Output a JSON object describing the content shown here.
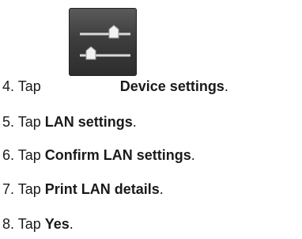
{
  "icon": {
    "name": "settings-sliders-icon",
    "color": "#3d3d3d"
  },
  "steps": [
    {
      "num": "4.",
      "verb": "Tap",
      "target": "Device settings",
      "punct": "."
    },
    {
      "num": "5.",
      "verb": "Tap",
      "target": "LAN settings",
      "punct": "."
    },
    {
      "num": "6.",
      "verb": "Tap",
      "target": "Confirm LAN settings",
      "punct": "."
    },
    {
      "num": "7.",
      "verb": "Tap",
      "target": "Print LAN details",
      "punct": "."
    },
    {
      "num": "8.",
      "verb": "Tap",
      "target": "Yes",
      "punct": "."
    }
  ]
}
